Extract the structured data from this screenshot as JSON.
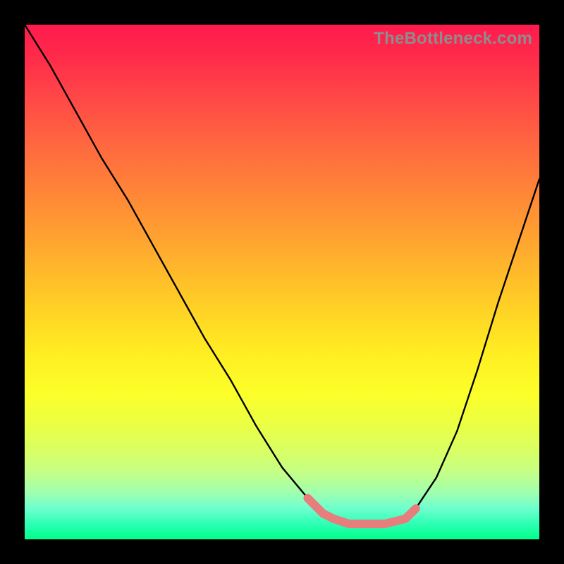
{
  "watermark": "TheBottleneck.com",
  "colors": {
    "background": "#000000",
    "gradient_top": "#ff1a4d",
    "gradient_bottom": "#00ff88",
    "curve": "#000000",
    "highlight": "#e77d7d",
    "watermark_text": "#8d8d8d"
  },
  "chart_data": {
    "type": "line",
    "title": "",
    "xlabel": "",
    "ylabel": "",
    "xlim": [
      0,
      100
    ],
    "ylim": [
      0,
      100
    ],
    "grid": false,
    "series": [
      {
        "name": "main-curve",
        "x": [
          0,
          5,
          10,
          15,
          20,
          25,
          30,
          35,
          40,
          45,
          50,
          55,
          58,
          60,
          63,
          66,
          70,
          74,
          76,
          80,
          84,
          88,
          92,
          96,
          100
        ],
        "y": [
          100,
          92,
          83,
          74,
          66,
          57,
          48,
          39,
          31,
          22,
          14,
          8,
          5,
          4,
          3,
          3,
          3,
          4,
          6,
          12,
          21,
          33,
          46,
          58,
          70
        ]
      }
    ],
    "highlight_segment": {
      "name": "optimal-region",
      "x": [
        55,
        58,
        60,
        63,
        66,
        70,
        74,
        76
      ],
      "y": [
        8,
        5,
        4,
        3,
        3,
        3,
        4,
        6
      ]
    }
  }
}
